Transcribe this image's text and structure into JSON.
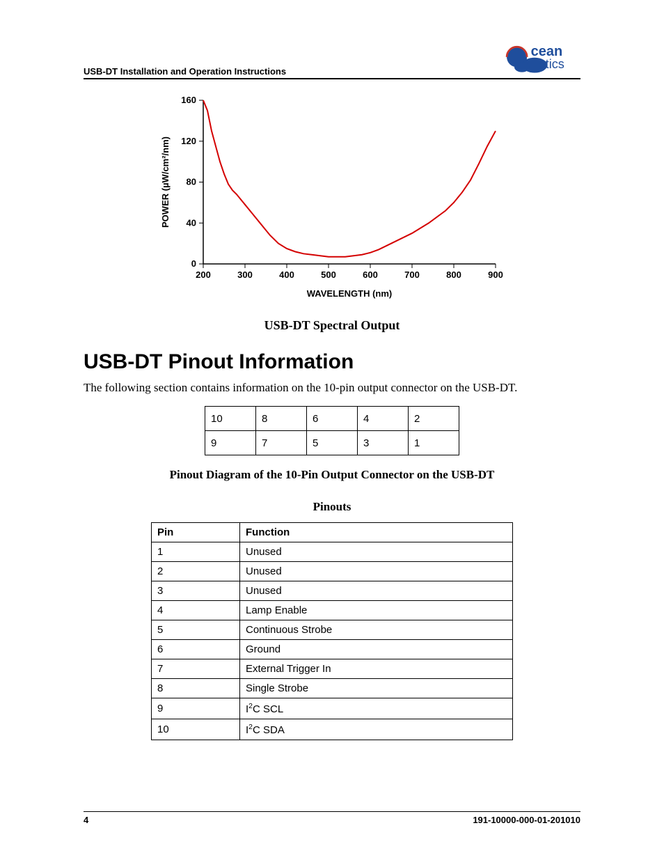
{
  "header": {
    "title": "USB-DT Installation and Operation Instructions",
    "brand_top": "cean",
    "brand_bottom": "ptics"
  },
  "chart_caption": "USB-DT Spectral Output",
  "chart_data": {
    "type": "line",
    "title": "",
    "xlabel": "WAVELENGTH (nm)",
    "ylabel": "POWER (µW/cm²/nm)",
    "xlim": [
      200,
      900
    ],
    "ylim": [
      0,
      160
    ],
    "xticks": [
      200,
      300,
      400,
      500,
      600,
      700,
      800,
      900
    ],
    "yticks": [
      0,
      40,
      80,
      120,
      160
    ],
    "series": [
      {
        "name": "USB-DT Spectral Output",
        "color": "#d40000",
        "x": [
          200,
          210,
          220,
          230,
          240,
          250,
          260,
          270,
          280,
          290,
          300,
          320,
          340,
          360,
          380,
          400,
          420,
          440,
          460,
          480,
          500,
          520,
          540,
          560,
          580,
          600,
          620,
          640,
          660,
          680,
          700,
          720,
          740,
          760,
          780,
          800,
          820,
          840,
          860,
          880,
          900
        ],
        "y": [
          160,
          150,
          130,
          115,
          100,
          88,
          78,
          72,
          68,
          63,
          58,
          48,
          38,
          28,
          20,
          15,
          12,
          10,
          9,
          8,
          7,
          7,
          7,
          8,
          9,
          11,
          14,
          18,
          22,
          26,
          30,
          35,
          40,
          46,
          52,
          60,
          70,
          82,
          98,
          115,
          130
        ]
      }
    ]
  },
  "section_heading": "USB-DT Pinout Information",
  "section_intro": "The following section contains information on the 10-pin output connector on the USB-DT.",
  "pin_grid": {
    "row1": [
      "10",
      "8",
      "6",
      "4",
      "2"
    ],
    "row2": [
      "9",
      "7",
      "5",
      "3",
      "1"
    ]
  },
  "pin_grid_caption": "Pinout Diagram of the 10-Pin Output Connector on the USB-DT",
  "pinouts_title": "Pinouts",
  "func_table": {
    "headers": [
      "Pin",
      "Function"
    ],
    "rows": [
      {
        "pin": "1",
        "func": "Unused"
      },
      {
        "pin": "2",
        "func": "Unused"
      },
      {
        "pin": "3",
        "func": "Unused"
      },
      {
        "pin": "4",
        "func": "Lamp Enable"
      },
      {
        "pin": "5",
        "func": "Continuous Strobe"
      },
      {
        "pin": "6",
        "func": "Ground"
      },
      {
        "pin": "7",
        "func": "External Trigger In"
      },
      {
        "pin": "8",
        "func": "Single Strobe"
      },
      {
        "pin": "9",
        "func": "I²C SCL",
        "func_html": "I<sup>2</sup>C SCL"
      },
      {
        "pin": "10",
        "func": "I²C SDA",
        "func_html": "I<sup>2</sup>C SDA"
      }
    ]
  },
  "footer": {
    "page": "4",
    "docnum": "191-10000-000-01-201010"
  }
}
